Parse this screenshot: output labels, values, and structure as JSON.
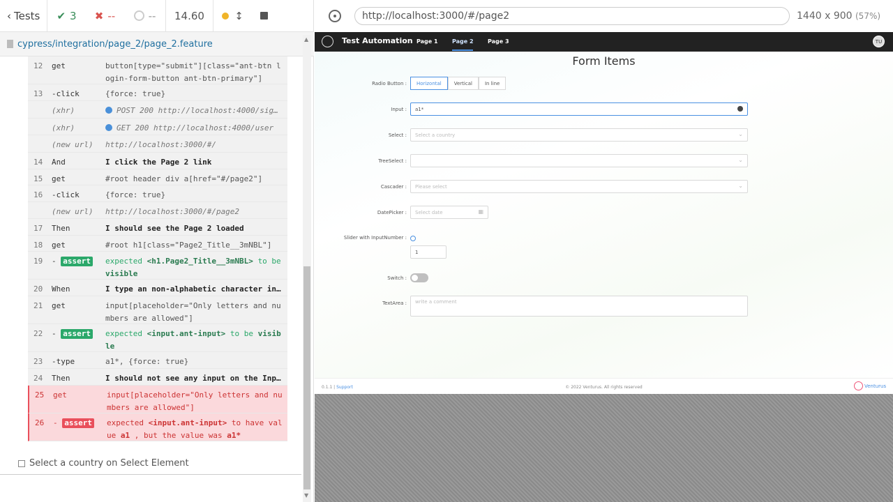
{
  "reporter": {
    "tests_label": "Tests",
    "passed": "3",
    "failed": "--",
    "pending": "--",
    "duration": "14.60",
    "spec_path": "cypress/integration/page_2/page_2.feature",
    "next_test": "Select a country on Select Element"
  },
  "commands": [
    {
      "num": "12",
      "cmd": "get",
      "msg": "button[type=\"submit\"][class=\"ant-btn login-form-button ant-btn-primary\"]"
    },
    {
      "num": "13",
      "cmd": "-click",
      "msg": "{force: true}"
    },
    {
      "num": "",
      "cmd": "(xhr)",
      "msg": "POST 200 http://localhost:4000/sig…"
    },
    {
      "num": "",
      "cmd": "(xhr)",
      "msg": "GET 200 http://localhost:4000/user"
    },
    {
      "num": "",
      "cmd": "(new url)",
      "msg": "http://localhost:3000/#/"
    },
    {
      "num": "14",
      "cmd": "And",
      "msg": "I click the Page 2 link"
    },
    {
      "num": "15",
      "cmd": "get",
      "msg": "#root header div a[href=\"#/page2\"]"
    },
    {
      "num": "16",
      "cmd": "-click",
      "msg": "{force: true}"
    },
    {
      "num": "",
      "cmd": "(new url)",
      "msg": "http://localhost:3000/#/page2"
    },
    {
      "num": "17",
      "cmd": "Then",
      "msg": "I should see the Page 2 loaded"
    },
    {
      "num": "18",
      "cmd": "get",
      "msg": "#root h1[class=\"Page2_Title__3mNBL\"]"
    },
    {
      "num": "19",
      "cmd": "assert",
      "msg_pre": "expected",
      "msg_kw": "<h1.Page2_Title__3mNBL>",
      "msg_mid": "to be",
      "msg_kw2": "visible"
    },
    {
      "num": "20",
      "cmd": "When",
      "msg": "I type an non-alphabetic character in…"
    },
    {
      "num": "21",
      "cmd": "get",
      "msg": "input[placeholder=\"Only letters and numbers are allowed\"]"
    },
    {
      "num": "22",
      "cmd": "assert",
      "msg_pre": "expected",
      "msg_kw": "<input.ant-input>",
      "msg_mid": "to be",
      "msg_kw2": "visible"
    },
    {
      "num": "23",
      "cmd": "-type",
      "msg": "a1*, {force: true}"
    },
    {
      "num": "24",
      "cmd": "Then",
      "msg": "I should not see any input on the Inp…"
    },
    {
      "num": "25",
      "cmd": "get",
      "msg": "input[placeholder=\"Only letters and numbers are allowed\"]"
    },
    {
      "num": "26",
      "cmd": "assert",
      "msg_pre": "expected",
      "msg_kw": "<input.ant-input>",
      "msg_mid": "to have value",
      "msg_kw2": "a1",
      "msg_post": ", but the value was",
      "msg_kw3": "a1*"
    }
  ],
  "aut": {
    "url": "http://localhost:3000/#/page2",
    "viewport": "1440 x 900",
    "scale": "(57%)"
  },
  "app": {
    "title": "Test Automation",
    "nav": [
      "Page 1",
      "Page 2",
      "Page 3"
    ],
    "avatar": "TU",
    "page_title": "Form Items",
    "labels": {
      "radio": "Radio Button :",
      "input": "Input :",
      "select": "Select :",
      "treeselect": "TreeSelect :",
      "cascader": "Cascader :",
      "datepicker": "DatePicker :",
      "slider": "Slider with InputNumber :",
      "switch": "Switch :",
      "textarea": "TextArea :"
    },
    "radio_options": [
      "Horizontal",
      "Vertical",
      "In line"
    ],
    "input_value": "a1*",
    "select_placeholder": "Select a country",
    "cascader_placeholder": "Please select",
    "datepicker_placeholder": "Select date",
    "number_value": "1",
    "textarea_placeholder": "write a comment",
    "footer_version": "0.1.1 |",
    "footer_support": "Support",
    "footer_copyright": "© 2022 Venturus. All rights reserved",
    "footer_brand": "Venturus"
  }
}
